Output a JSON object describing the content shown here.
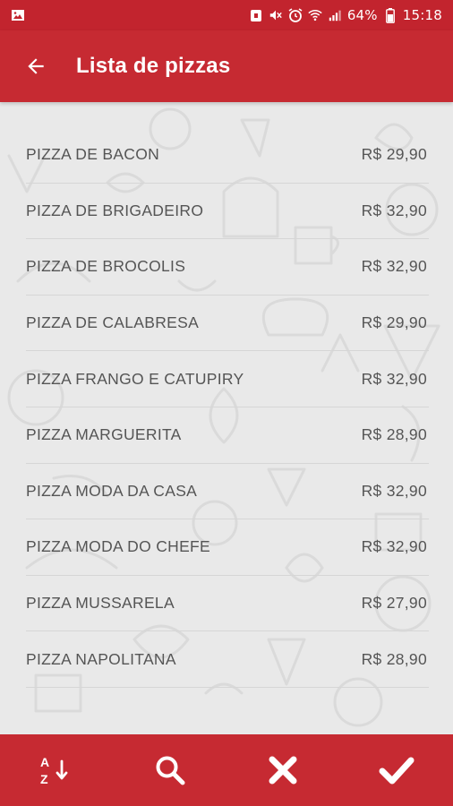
{
  "status_bar": {
    "battery": "64%",
    "time": "15:18"
  },
  "app_bar": {
    "title": "Lista de pizzas",
    "back_icon": "arrow-back-icon"
  },
  "pizzas": [
    {
      "name": "PIZZA DE BACON",
      "price": "R$ 29,90"
    },
    {
      "name": "PIZZA DE BRIGADEIRO",
      "price": "R$ 32,90"
    },
    {
      "name": "PIZZA DE BROCOLIS",
      "price": "R$ 32,90"
    },
    {
      "name": "PIZZA DE CALABRESA",
      "price": "R$ 29,90"
    },
    {
      "name": "PIZZA FRANGO E CATUPIRY",
      "price": "R$ 32,90"
    },
    {
      "name": "PIZZA MARGUERITA",
      "price": "R$ 28,90"
    },
    {
      "name": "PIZZA MODA DA CASA",
      "price": "R$ 32,90"
    },
    {
      "name": "PIZZA MODA DO CHEFE",
      "price": "R$ 32,90"
    },
    {
      "name": "PIZZA MUSSARELA",
      "price": "R$ 27,90"
    },
    {
      "name": "PIZZA NAPOLITANA",
      "price": "R$ 28,90"
    }
  ],
  "bottom_bar": {
    "actions": [
      "sort-az-icon",
      "search-icon",
      "close-icon",
      "check-icon"
    ]
  },
  "colors": {
    "primary": "#c62a32",
    "status_bar": "#c2242e",
    "background": "#e9e9e9",
    "text": "#555555"
  }
}
